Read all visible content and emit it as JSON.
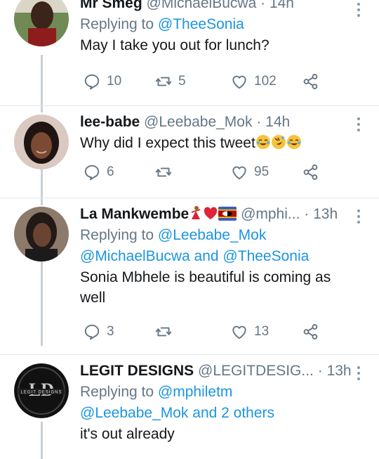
{
  "tweets": [
    {
      "name": "Mr Smeg",
      "handle": "@MichaelBucwa",
      "separator": "·",
      "time": "14h",
      "replying_prefix": "Replying to",
      "replying_line1": "@TheeSonia",
      "replying_line2": "",
      "text_line1": "May I take you out for lunch?",
      "text_line2": "",
      "replies": "10",
      "retweets": "5",
      "likes": "102"
    },
    {
      "name": "lee-babe",
      "handle": "@Leebabe_Mok",
      "separator": "·",
      "time": "14h",
      "text_line1": "Why did I expect this tweet",
      "emojis": [
        "face-with-tears-of-joy",
        "rolling-on-floor-laughing",
        "face-with-tears-of-joy"
      ],
      "replies": "6",
      "retweets": "",
      "likes": "95"
    },
    {
      "name": "La Mankwembe",
      "name_emojis": [
        "dancer-woman",
        "red-heart",
        "flag-eswatini"
      ],
      "handle": "@mphi...",
      "separator": "·",
      "time": "13h",
      "replying_prefix": "Replying to",
      "replying_line1": "@Leebabe_Mok",
      "replying_line2": "@MichaelBucwa and @TheeSonia",
      "text_line1": "Sonia Mbhele  is beautiful is coming as",
      "text_line2": "well",
      "replies": "3",
      "retweets": "",
      "likes": "13"
    },
    {
      "name": "LEGIT DESIGNS",
      "handle": "@LEGITDESIG...",
      "separator": "·",
      "time": "13h",
      "avatar_text": "LEGIT DESIGNS",
      "replying_prefix": "Replying to",
      "replying_line1": "@mphiletm",
      "replying_line2": "@Leebabe_Mok and 2 others",
      "text_line1": "it's out already"
    }
  ],
  "colors": {
    "link": "#1b95e0",
    "muted": "#657786",
    "divider": "#e3e6e8",
    "thread_line": "#c8d0d6"
  }
}
